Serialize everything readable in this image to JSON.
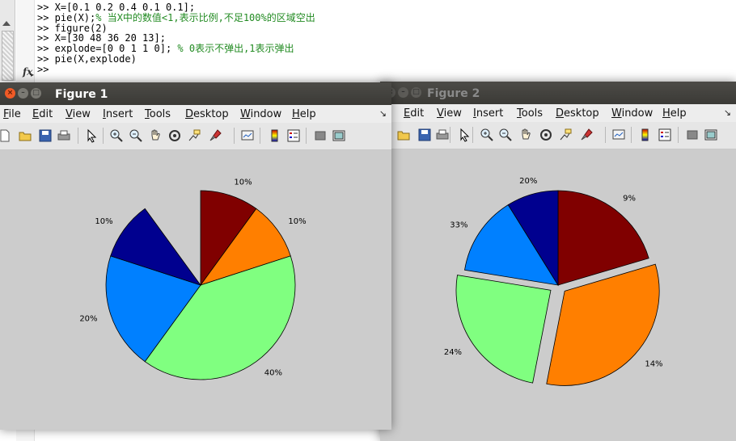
{
  "command_window": {
    "lines": [
      {
        "code": ">> X=[0.1 0.2 0.4 0.1 0.1];",
        "comment": ""
      },
      {
        "code": ">> pie(X);",
        "comment": "% 当X中的数值<1,表示比例,不足100%的区域空出"
      },
      {
        "code": ">> figure(2)",
        "comment": ""
      },
      {
        "code": ">> X=[30 48 36 20 13];",
        "comment": ""
      },
      {
        "code": ">> explode=[0 0 1 1 0];",
        "comment": " % 0表示不弹出,1表示弹出"
      },
      {
        "code": ">> pie(X,explode)",
        "comment": ""
      },
      {
        "code": ">>",
        "comment": ""
      }
    ],
    "fx_label": "fx"
  },
  "figure1": {
    "title": "Figure 1",
    "menu": [
      "File",
      "Edit",
      "View",
      "Insert",
      "Tools",
      "Desktop",
      "Window",
      "Help"
    ],
    "dock_icon": "dock-arrow-icon"
  },
  "figure2": {
    "title": "Figure 2",
    "menu": [
      "Edit",
      "View",
      "Insert",
      "Tools",
      "Desktop",
      "Window",
      "Help"
    ],
    "dock_icon": "dock-arrow-icon"
  },
  "toolbar_icons": [
    "new-figure-icon",
    "open-file-icon",
    "save-icon",
    "print-icon",
    "select-arrow-icon",
    "zoom-in-icon",
    "zoom-out-icon",
    "pan-hand-icon",
    "rotate-3d-icon",
    "data-cursor-icon",
    "brush-icon",
    "link-plot-icon",
    "colorbar-icon",
    "legend-icon",
    "hide-plot-tools-icon",
    "show-plot-tools-icon"
  ],
  "colors": {
    "slice1": "#800000",
    "slice2": "#ff7f00",
    "slice3": "#80ff80",
    "slice4": "#0080ff",
    "slice5": "#00008f",
    "plot_bg": "#cccccc",
    "comment": "#228b22",
    "title_active": "#ffffff",
    "title_inactive": "#8a8a8a"
  },
  "chart_data": [
    {
      "type": "pie",
      "values": [
        0.1,
        0.1,
        0.4,
        0.2,
        0.1
      ],
      "labels": [
        "10%",
        "10%",
        "40%",
        "20%",
        "10%"
      ],
      "explode": [
        0,
        0,
        0,
        0,
        0
      ],
      "partial": true,
      "title": ""
    },
    {
      "type": "pie",
      "values": [
        30,
        48,
        36,
        20,
        13
      ],
      "labels": [
        "9%",
        "14%",
        "24%",
        "33%",
        "20%"
      ],
      "explode": [
        0,
        1,
        1,
        0,
        0
      ],
      "title": ""
    }
  ]
}
